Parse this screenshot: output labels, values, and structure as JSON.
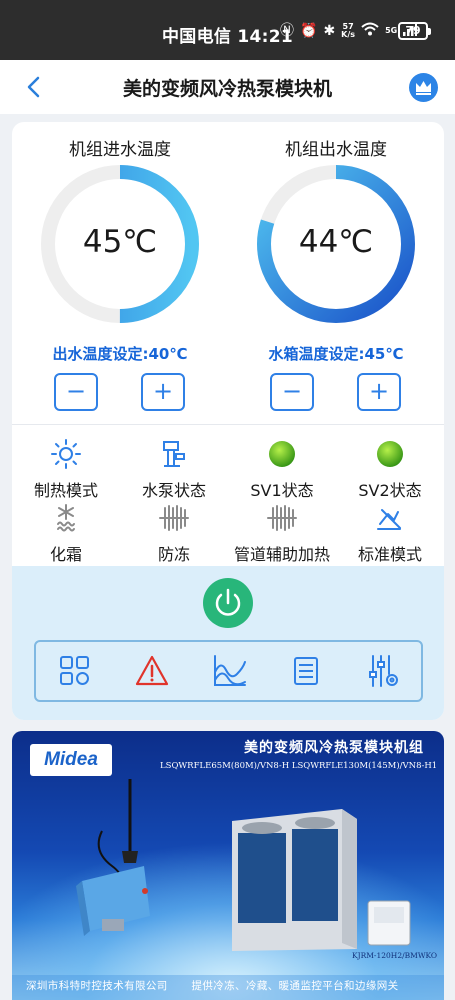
{
  "status_bar": {
    "carrier_time": "中国电信 14:21",
    "net_speed_top": "57",
    "net_speed_bottom": "K/s",
    "signal_label": "5G",
    "battery": "79"
  },
  "nav": {
    "title": "美的变频风冷热泵模块机"
  },
  "gauges": [
    {
      "label": "机组进水温度",
      "value": "45℃",
      "level": 0.5,
      "setpoint": "出水温度设定:40℃",
      "minus": "−",
      "plus": "+"
    },
    {
      "label": "机组出水温度",
      "value": "44℃",
      "level": 0.8,
      "setpoint": "水箱温度设定:45℃",
      "minus": "−",
      "plus": "+"
    }
  ],
  "status_items": [
    {
      "label": "制热模式",
      "icon": "sun-icon"
    },
    {
      "label": "水泵状态",
      "icon": "pump-icon"
    },
    {
      "label": "SV1状态",
      "icon": "green-indicator-icon"
    },
    {
      "label": "SV2状态",
      "icon": "green-indicator-icon"
    },
    {
      "label": "化霜",
      "icon": "defrost-icon"
    },
    {
      "label": "防冻",
      "icon": "antifreeze-icon"
    },
    {
      "label": "管道辅助加热",
      "icon": "pipe-heater-icon"
    },
    {
      "label": "标准模式",
      "icon": "standard-mode-icon"
    }
  ],
  "toolbar": [
    "grid-icon",
    "alarm-icon",
    "chart-icon",
    "list-icon",
    "settings-sliders-icon"
  ],
  "banner": {
    "logo": "Midea",
    "title": "美的变频风冷热泵模块机组",
    "models": "LSQWRFLE65M(80M)/VN8-H  LSQWRFLE130M(145M)/VN8-H1",
    "device_model": "KJRM-120H2/BMWKO",
    "footer_company": "深圳市科特时控技术有限公司",
    "footer_tagline": "提供冷冻、冷藏、暖通监控平台和边缘网关"
  },
  "colors": {
    "accent": "#2f80e6",
    "setpoint_text": "#1665d8",
    "power": "#28b67a",
    "indicator_green": "#3fae1e",
    "alarm_red": "#e0342b",
    "control_bg": "#dbeefa"
  }
}
